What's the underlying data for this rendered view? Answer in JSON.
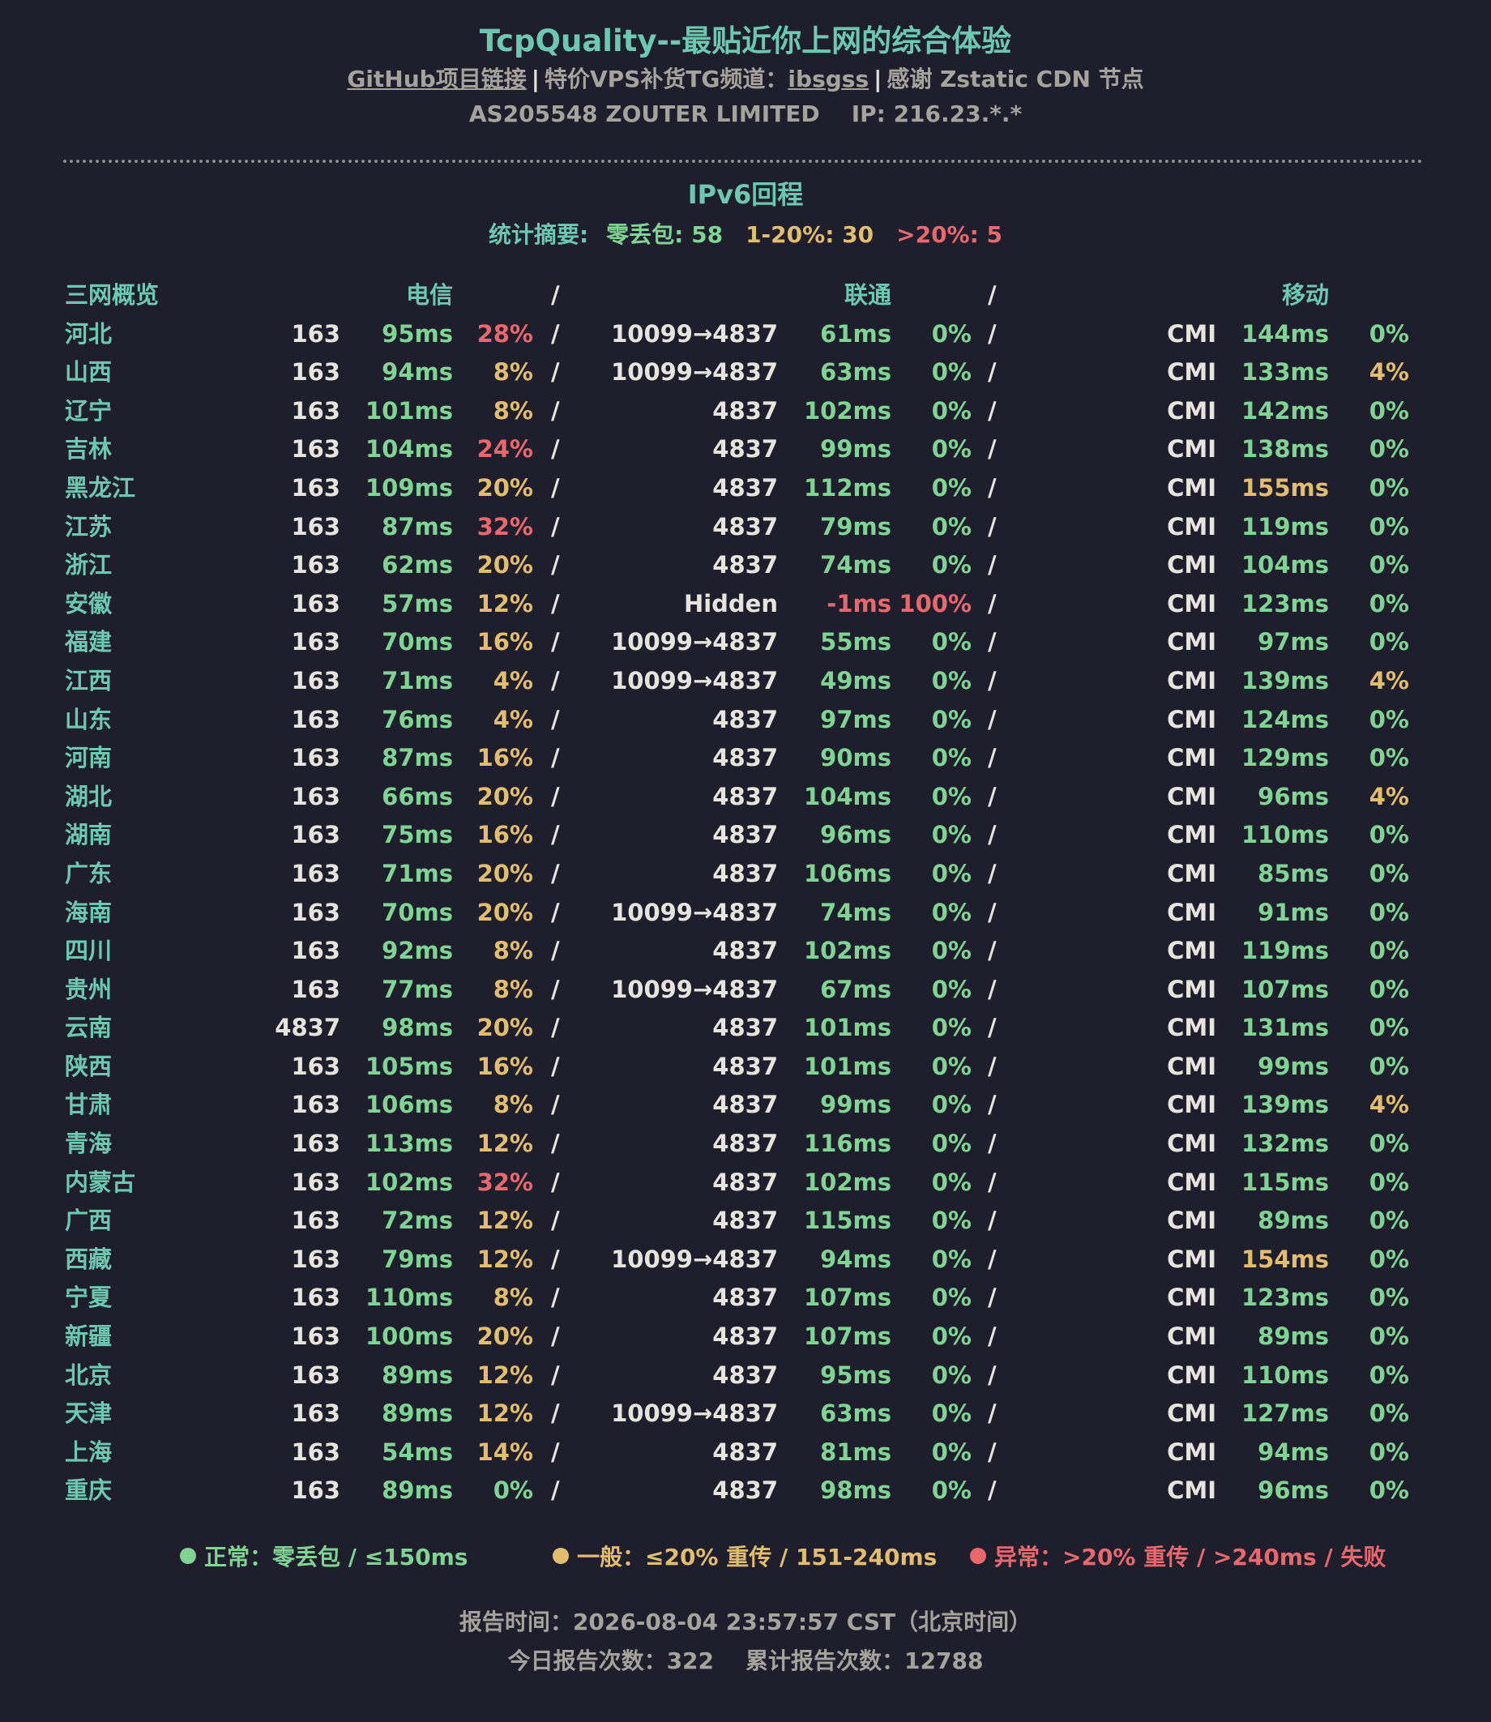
{
  "header": {
    "title": "TcpQuality--最贴近你上网的综合体验",
    "github_link": "GitHub项目链接",
    "sep": "|",
    "tg_prefix": "特价VPS补货TG频道：",
    "tg_link": "ibsgss",
    "cdn_text": "感谢 Zstatic CDN 节点",
    "as_info": "AS205548 ZOUTER LIMITED",
    "ip_info": "IP: 216.23.*.*"
  },
  "section": {
    "title": "IPv6回程",
    "summary_label": "统计摘要:",
    "zero_loss": "零丢包: 58",
    "mid_loss": "1-20%: 30",
    "high_loss": ">20%: 5"
  },
  "table": {
    "headers": {
      "overview": "三网概览",
      "ct": "电信",
      "cu": "联通",
      "cm": "移动",
      "slash": "/"
    },
    "rows": [
      {
        "prov": "河北",
        "ct_asn": "163",
        "ct_lat": "95ms",
        "ct_lat_c": "green",
        "ct_loss": "28%",
        "ct_loss_c": "red",
        "cu_asn": "10099→4837",
        "cu_lat": "61ms",
        "cu_lat_c": "green",
        "cu_loss": "0%",
        "cu_loss_c": "green",
        "cm_asn": "CMI",
        "cm_lat": "144ms",
        "cm_lat_c": "green",
        "cm_loss": "0%",
        "cm_loss_c": "green"
      },
      {
        "prov": "山西",
        "ct_asn": "163",
        "ct_lat": "94ms",
        "ct_lat_c": "green",
        "ct_loss": "8%",
        "ct_loss_c": "yellow",
        "cu_asn": "10099→4837",
        "cu_lat": "63ms",
        "cu_lat_c": "green",
        "cu_loss": "0%",
        "cu_loss_c": "green",
        "cm_asn": "CMI",
        "cm_lat": "133ms",
        "cm_lat_c": "green",
        "cm_loss": "4%",
        "cm_loss_c": "yellow"
      },
      {
        "prov": "辽宁",
        "ct_asn": "163",
        "ct_lat": "101ms",
        "ct_lat_c": "green",
        "ct_loss": "8%",
        "ct_loss_c": "yellow",
        "cu_asn": "4837",
        "cu_lat": "102ms",
        "cu_lat_c": "green",
        "cu_loss": "0%",
        "cu_loss_c": "green",
        "cm_asn": "CMI",
        "cm_lat": "142ms",
        "cm_lat_c": "green",
        "cm_loss": "0%",
        "cm_loss_c": "green"
      },
      {
        "prov": "吉林",
        "ct_asn": "163",
        "ct_lat": "104ms",
        "ct_lat_c": "green",
        "ct_loss": "24%",
        "ct_loss_c": "red",
        "cu_asn": "4837",
        "cu_lat": "99ms",
        "cu_lat_c": "green",
        "cu_loss": "0%",
        "cu_loss_c": "green",
        "cm_asn": "CMI",
        "cm_lat": "138ms",
        "cm_lat_c": "green",
        "cm_loss": "0%",
        "cm_loss_c": "green"
      },
      {
        "prov": "黑龙江",
        "ct_asn": "163",
        "ct_lat": "109ms",
        "ct_lat_c": "green",
        "ct_loss": "20%",
        "ct_loss_c": "yellow",
        "cu_asn": "4837",
        "cu_lat": "112ms",
        "cu_lat_c": "green",
        "cu_loss": "0%",
        "cu_loss_c": "green",
        "cm_asn": "CMI",
        "cm_lat": "155ms",
        "cm_lat_c": "yellow",
        "cm_loss": "0%",
        "cm_loss_c": "green"
      },
      {
        "prov": "江苏",
        "ct_asn": "163",
        "ct_lat": "87ms",
        "ct_lat_c": "green",
        "ct_loss": "32%",
        "ct_loss_c": "red",
        "cu_asn": "4837",
        "cu_lat": "79ms",
        "cu_lat_c": "green",
        "cu_loss": "0%",
        "cu_loss_c": "green",
        "cm_asn": "CMI",
        "cm_lat": "119ms",
        "cm_lat_c": "green",
        "cm_loss": "0%",
        "cm_loss_c": "green"
      },
      {
        "prov": "浙江",
        "ct_asn": "163",
        "ct_lat": "62ms",
        "ct_lat_c": "green",
        "ct_loss": "20%",
        "ct_loss_c": "yellow",
        "cu_asn": "4837",
        "cu_lat": "74ms",
        "cu_lat_c": "green",
        "cu_loss": "0%",
        "cu_loss_c": "green",
        "cm_asn": "CMI",
        "cm_lat": "104ms",
        "cm_lat_c": "green",
        "cm_loss": "0%",
        "cm_loss_c": "green"
      },
      {
        "prov": "安徽",
        "ct_asn": "163",
        "ct_lat": "57ms",
        "ct_lat_c": "green",
        "ct_loss": "12%",
        "ct_loss_c": "yellow",
        "cu_asn": "Hidden",
        "cu_lat": "-1ms",
        "cu_lat_c": "red",
        "cu_loss": "100%",
        "cu_loss_c": "red",
        "cm_asn": "CMI",
        "cm_lat": "123ms",
        "cm_lat_c": "green",
        "cm_loss": "0%",
        "cm_loss_c": "green"
      },
      {
        "prov": "福建",
        "ct_asn": "163",
        "ct_lat": "70ms",
        "ct_lat_c": "green",
        "ct_loss": "16%",
        "ct_loss_c": "yellow",
        "cu_asn": "10099→4837",
        "cu_lat": "55ms",
        "cu_lat_c": "green",
        "cu_loss": "0%",
        "cu_loss_c": "green",
        "cm_asn": "CMI",
        "cm_lat": "97ms",
        "cm_lat_c": "green",
        "cm_loss": "0%",
        "cm_loss_c": "green"
      },
      {
        "prov": "江西",
        "ct_asn": "163",
        "ct_lat": "71ms",
        "ct_lat_c": "green",
        "ct_loss": "4%",
        "ct_loss_c": "yellow",
        "cu_asn": "10099→4837",
        "cu_lat": "49ms",
        "cu_lat_c": "green",
        "cu_loss": "0%",
        "cu_loss_c": "green",
        "cm_asn": "CMI",
        "cm_lat": "139ms",
        "cm_lat_c": "green",
        "cm_loss": "4%",
        "cm_loss_c": "yellow"
      },
      {
        "prov": "山东",
        "ct_asn": "163",
        "ct_lat": "76ms",
        "ct_lat_c": "green",
        "ct_loss": "4%",
        "ct_loss_c": "yellow",
        "cu_asn": "4837",
        "cu_lat": "97ms",
        "cu_lat_c": "green",
        "cu_loss": "0%",
        "cu_loss_c": "green",
        "cm_asn": "CMI",
        "cm_lat": "124ms",
        "cm_lat_c": "green",
        "cm_loss": "0%",
        "cm_loss_c": "green"
      },
      {
        "prov": "河南",
        "ct_asn": "163",
        "ct_lat": "87ms",
        "ct_lat_c": "green",
        "ct_loss": "16%",
        "ct_loss_c": "yellow",
        "cu_asn": "4837",
        "cu_lat": "90ms",
        "cu_lat_c": "green",
        "cu_loss": "0%",
        "cu_loss_c": "green",
        "cm_asn": "CMI",
        "cm_lat": "129ms",
        "cm_lat_c": "green",
        "cm_loss": "0%",
        "cm_loss_c": "green"
      },
      {
        "prov": "湖北",
        "ct_asn": "163",
        "ct_lat": "66ms",
        "ct_lat_c": "green",
        "ct_loss": "20%",
        "ct_loss_c": "yellow",
        "cu_asn": "4837",
        "cu_lat": "104ms",
        "cu_lat_c": "green",
        "cu_loss": "0%",
        "cu_loss_c": "green",
        "cm_asn": "CMI",
        "cm_lat": "96ms",
        "cm_lat_c": "green",
        "cm_loss": "4%",
        "cm_loss_c": "yellow"
      },
      {
        "prov": "湖南",
        "ct_asn": "163",
        "ct_lat": "75ms",
        "ct_lat_c": "green",
        "ct_loss": "16%",
        "ct_loss_c": "yellow",
        "cu_asn": "4837",
        "cu_lat": "96ms",
        "cu_lat_c": "green",
        "cu_loss": "0%",
        "cu_loss_c": "green",
        "cm_asn": "CMI",
        "cm_lat": "110ms",
        "cm_lat_c": "green",
        "cm_loss": "0%",
        "cm_loss_c": "green"
      },
      {
        "prov": "广东",
        "ct_asn": "163",
        "ct_lat": "71ms",
        "ct_lat_c": "green",
        "ct_loss": "20%",
        "ct_loss_c": "yellow",
        "cu_asn": "4837",
        "cu_lat": "106ms",
        "cu_lat_c": "green",
        "cu_loss": "0%",
        "cu_loss_c": "green",
        "cm_asn": "CMI",
        "cm_lat": "85ms",
        "cm_lat_c": "green",
        "cm_loss": "0%",
        "cm_loss_c": "green"
      },
      {
        "prov": "海南",
        "ct_asn": "163",
        "ct_lat": "70ms",
        "ct_lat_c": "green",
        "ct_loss": "20%",
        "ct_loss_c": "yellow",
        "cu_asn": "10099→4837",
        "cu_lat": "74ms",
        "cu_lat_c": "green",
        "cu_loss": "0%",
        "cu_loss_c": "green",
        "cm_asn": "CMI",
        "cm_lat": "91ms",
        "cm_lat_c": "green",
        "cm_loss": "0%",
        "cm_loss_c": "green"
      },
      {
        "prov": "四川",
        "ct_asn": "163",
        "ct_lat": "92ms",
        "ct_lat_c": "green",
        "ct_loss": "8%",
        "ct_loss_c": "yellow",
        "cu_asn": "4837",
        "cu_lat": "102ms",
        "cu_lat_c": "green",
        "cu_loss": "0%",
        "cu_loss_c": "green",
        "cm_asn": "CMI",
        "cm_lat": "119ms",
        "cm_lat_c": "green",
        "cm_loss": "0%",
        "cm_loss_c": "green"
      },
      {
        "prov": "贵州",
        "ct_asn": "163",
        "ct_lat": "77ms",
        "ct_lat_c": "green",
        "ct_loss": "8%",
        "ct_loss_c": "yellow",
        "cu_asn": "10099→4837",
        "cu_lat": "67ms",
        "cu_lat_c": "green",
        "cu_loss": "0%",
        "cu_loss_c": "green",
        "cm_asn": "CMI",
        "cm_lat": "107ms",
        "cm_lat_c": "green",
        "cm_loss": "0%",
        "cm_loss_c": "green"
      },
      {
        "prov": "云南",
        "ct_asn": "4837",
        "ct_lat": "98ms",
        "ct_lat_c": "green",
        "ct_loss": "20%",
        "ct_loss_c": "yellow",
        "cu_asn": "4837",
        "cu_lat": "101ms",
        "cu_lat_c": "green",
        "cu_loss": "0%",
        "cu_loss_c": "green",
        "cm_asn": "CMI",
        "cm_lat": "131ms",
        "cm_lat_c": "green",
        "cm_loss": "0%",
        "cm_loss_c": "green"
      },
      {
        "prov": "陕西",
        "ct_asn": "163",
        "ct_lat": "105ms",
        "ct_lat_c": "green",
        "ct_loss": "16%",
        "ct_loss_c": "yellow",
        "cu_asn": "4837",
        "cu_lat": "101ms",
        "cu_lat_c": "green",
        "cu_loss": "0%",
        "cu_loss_c": "green",
        "cm_asn": "CMI",
        "cm_lat": "99ms",
        "cm_lat_c": "green",
        "cm_loss": "0%",
        "cm_loss_c": "green"
      },
      {
        "prov": "甘肃",
        "ct_asn": "163",
        "ct_lat": "106ms",
        "ct_lat_c": "green",
        "ct_loss": "8%",
        "ct_loss_c": "yellow",
        "cu_asn": "4837",
        "cu_lat": "99ms",
        "cu_lat_c": "green",
        "cu_loss": "0%",
        "cu_loss_c": "green",
        "cm_asn": "CMI",
        "cm_lat": "139ms",
        "cm_lat_c": "green",
        "cm_loss": "4%",
        "cm_loss_c": "yellow"
      },
      {
        "prov": "青海",
        "ct_asn": "163",
        "ct_lat": "113ms",
        "ct_lat_c": "green",
        "ct_loss": "12%",
        "ct_loss_c": "yellow",
        "cu_asn": "4837",
        "cu_lat": "116ms",
        "cu_lat_c": "green",
        "cu_loss": "0%",
        "cu_loss_c": "green",
        "cm_asn": "CMI",
        "cm_lat": "132ms",
        "cm_lat_c": "green",
        "cm_loss": "0%",
        "cm_loss_c": "green"
      },
      {
        "prov": "内蒙古",
        "ct_asn": "163",
        "ct_lat": "102ms",
        "ct_lat_c": "green",
        "ct_loss": "32%",
        "ct_loss_c": "red",
        "cu_asn": "4837",
        "cu_lat": "102ms",
        "cu_lat_c": "green",
        "cu_loss": "0%",
        "cu_loss_c": "green",
        "cm_asn": "CMI",
        "cm_lat": "115ms",
        "cm_lat_c": "green",
        "cm_loss": "0%",
        "cm_loss_c": "green"
      },
      {
        "prov": "广西",
        "ct_asn": "163",
        "ct_lat": "72ms",
        "ct_lat_c": "green",
        "ct_loss": "12%",
        "ct_loss_c": "yellow",
        "cu_asn": "4837",
        "cu_lat": "115ms",
        "cu_lat_c": "green",
        "cu_loss": "0%",
        "cu_loss_c": "green",
        "cm_asn": "CMI",
        "cm_lat": "89ms",
        "cm_lat_c": "green",
        "cm_loss": "0%",
        "cm_loss_c": "green"
      },
      {
        "prov": "西藏",
        "ct_asn": "163",
        "ct_lat": "79ms",
        "ct_lat_c": "green",
        "ct_loss": "12%",
        "ct_loss_c": "yellow",
        "cu_asn": "10099→4837",
        "cu_lat": "94ms",
        "cu_lat_c": "green",
        "cu_loss": "0%",
        "cu_loss_c": "green",
        "cm_asn": "CMI",
        "cm_lat": "154ms",
        "cm_lat_c": "yellow",
        "cm_loss": "0%",
        "cm_loss_c": "green"
      },
      {
        "prov": "宁夏",
        "ct_asn": "163",
        "ct_lat": "110ms",
        "ct_lat_c": "green",
        "ct_loss": "8%",
        "ct_loss_c": "yellow",
        "cu_asn": "4837",
        "cu_lat": "107ms",
        "cu_lat_c": "green",
        "cu_loss": "0%",
        "cu_loss_c": "green",
        "cm_asn": "CMI",
        "cm_lat": "123ms",
        "cm_lat_c": "green",
        "cm_loss": "0%",
        "cm_loss_c": "green"
      },
      {
        "prov": "新疆",
        "ct_asn": "163",
        "ct_lat": "100ms",
        "ct_lat_c": "green",
        "ct_loss": "20%",
        "ct_loss_c": "yellow",
        "cu_asn": "4837",
        "cu_lat": "107ms",
        "cu_lat_c": "green",
        "cu_loss": "0%",
        "cu_loss_c": "green",
        "cm_asn": "CMI",
        "cm_lat": "89ms",
        "cm_lat_c": "green",
        "cm_loss": "0%",
        "cm_loss_c": "green"
      },
      {
        "prov": "北京",
        "ct_asn": "163",
        "ct_lat": "89ms",
        "ct_lat_c": "green",
        "ct_loss": "12%",
        "ct_loss_c": "yellow",
        "cu_asn": "4837",
        "cu_lat": "95ms",
        "cu_lat_c": "green",
        "cu_loss": "0%",
        "cu_loss_c": "green",
        "cm_asn": "CMI",
        "cm_lat": "110ms",
        "cm_lat_c": "green",
        "cm_loss": "0%",
        "cm_loss_c": "green"
      },
      {
        "prov": "天津",
        "ct_asn": "163",
        "ct_lat": "89ms",
        "ct_lat_c": "green",
        "ct_loss": "12%",
        "ct_loss_c": "yellow",
        "cu_asn": "10099→4837",
        "cu_lat": "63ms",
        "cu_lat_c": "green",
        "cu_loss": "0%",
        "cu_loss_c": "green",
        "cm_asn": "CMI",
        "cm_lat": "127ms",
        "cm_lat_c": "green",
        "cm_loss": "0%",
        "cm_loss_c": "green"
      },
      {
        "prov": "上海",
        "ct_asn": "163",
        "ct_lat": "54ms",
        "ct_lat_c": "green",
        "ct_loss": "14%",
        "ct_loss_c": "yellow",
        "cu_asn": "4837",
        "cu_lat": "81ms",
        "cu_lat_c": "green",
        "cu_loss": "0%",
        "cu_loss_c": "green",
        "cm_asn": "CMI",
        "cm_lat": "94ms",
        "cm_lat_c": "green",
        "cm_loss": "0%",
        "cm_loss_c": "green"
      },
      {
        "prov": "重庆",
        "ct_asn": "163",
        "ct_lat": "89ms",
        "ct_lat_c": "green",
        "ct_loss": "0%",
        "ct_loss_c": "green",
        "cu_asn": "4837",
        "cu_lat": "98ms",
        "cu_lat_c": "green",
        "cu_loss": "0%",
        "cu_loss_c": "green",
        "cm_asn": "CMI",
        "cm_lat": "96ms",
        "cm_lat_c": "green",
        "cm_loss": "0%",
        "cm_loss_c": "green"
      }
    ]
  },
  "legend": {
    "normal": "正常：零丢包 / ≤150ms",
    "medium": "一般：≤20% 重传 / 151-240ms",
    "abnormal": "异常：>20% 重传 / >240ms / 失败"
  },
  "footer": {
    "report_time": "报告时间：2026-08-04 23:57:57 CST（北京时间）",
    "today_count": "今日报告次数：322",
    "total_count": "累计报告次数：12788"
  },
  "colors": {
    "background": "#1e1e2c",
    "teal": "#6cc8b0",
    "green": "#7fd493",
    "yellow": "#e3bd6e",
    "red": "#e9686e",
    "gray": "#a5a39c",
    "white": "#e6e4dc"
  }
}
